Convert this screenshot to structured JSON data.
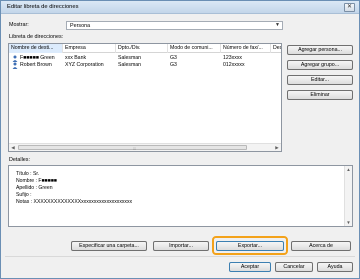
{
  "window": {
    "title": "Editar libreta de direcciones",
    "close_symbol": "✕"
  },
  "show": {
    "label": "Mostrar:",
    "value": "Persona"
  },
  "address_book": {
    "label": "Libreta de direcciones:",
    "columns": [
      "Nombre de desti...",
      "Empresa",
      "Dpto./Div.",
      "Modo de comuni...",
      "Número de fax/...",
      "Desti"
    ],
    "rows": [
      {
        "name": "F■■■■■ Green",
        "company": "xxx Bank",
        "dept": "Salesman",
        "mode": "G3",
        "number": "123xxxx"
      },
      {
        "name": "Robert Brown",
        "company": "XYZ Corporation",
        "dept": "Salesman",
        "mode": "G3",
        "number": "012xxxxx"
      }
    ]
  },
  "side_buttons": {
    "add_person": "Agregar persona...",
    "add_group": "Agregar grupo...",
    "edit": "Editar...",
    "delete": "Eliminar"
  },
  "details": {
    "label": "Detalles:",
    "lines": [
      "Título   : Sr.",
      "Nombre : F■■■■■",
      "Apellido : Green",
      "Sufijo   :",
      "Notas   : XXXXXXXXXXXXXXxxxxxxxxxxxxxxxxxxxx"
    ]
  },
  "bottom_buttons": {
    "specify_folder": "Especificar una carpeta...",
    "import": "Importar...",
    "export": "Exportar...",
    "about": "Acerca de"
  },
  "dialog_buttons": {
    "ok": "Aceptar",
    "cancel": "Cancelar",
    "help": "Ayuda"
  },
  "colors": {
    "highlight": "#f3a21a",
    "sorted_header": "#dcebfc"
  }
}
